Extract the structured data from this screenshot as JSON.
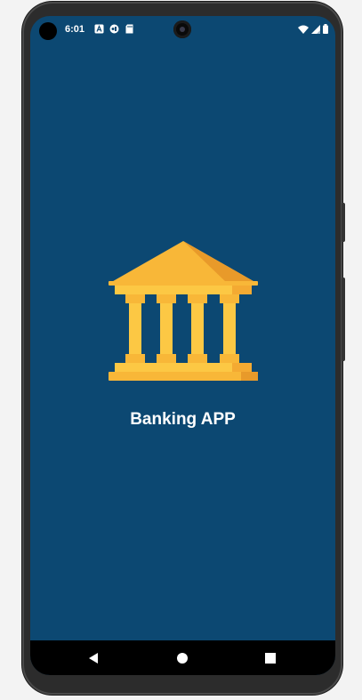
{
  "status_bar": {
    "time": "6:01",
    "notification_icons": [
      "a-icon",
      "tsv-icon",
      "sd-card-icon"
    ],
    "system_icons": [
      "wifi-icon",
      "signal-icon",
      "battery-icon"
    ]
  },
  "splash": {
    "logo_icon": "bank-building-icon",
    "title": "Banking APP"
  },
  "navigation_bar": {
    "buttons": [
      "back",
      "home",
      "recents"
    ]
  },
  "colors": {
    "background": "#0c4872",
    "logo_primary": "#f8b738",
    "logo_secondary": "#fcc844",
    "logo_shadow": "#e89a2a",
    "nav_bar": "#000000"
  }
}
